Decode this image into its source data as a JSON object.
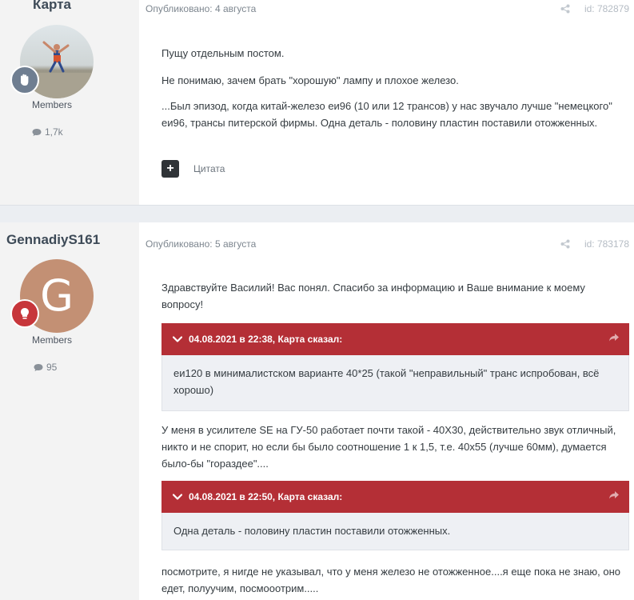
{
  "posts": [
    {
      "author": "Карта",
      "group": "Members",
      "post_count": "1,7k",
      "published": "Опубликовано: 4 августа",
      "id_label": "id: 782879",
      "paragraphs": [
        "Пущу отдельным постом.",
        "Не понимаю, зачем брать \"хорошую\" лампу и плохое железо.",
        "...Был эпизод, когда китай-железо еи96 (10 или 12 трансов) у нас звучало лучше \"немецкого\" еи96, трансы питерской фирмы. Одна деталь - половину пластин поставили отожженных."
      ],
      "quote_label": "Цитата"
    },
    {
      "author": "GennadiyS161",
      "avatar_letter": "G",
      "group": "Members",
      "post_count": "95",
      "published": "Опубликовано: 5 августа",
      "id_label": "id: 783178",
      "intro": "Здравствуйте Василий! Вас понял. Спасибо за информацию и Ваше внимание к моему вопросу!",
      "quote1": {
        "header": "04.08.2021 в 22:38, Карта сказал:",
        "text": "еи120 в минималистском варианте 40*25 (такой \"неправильный\" транс испробован, всё хорошо)"
      },
      "middle": "У меня в усилителе SE на ГУ-50 работает почти такой - 40Х30, действительно звук отличный, никто и не спорит, но если бы было соотношение 1 к 1,5, т.е. 40х55 (лучше 60мм), думается было-бы \"гораздее\"....",
      "quote2": {
        "header": "04.08.2021 в 22:50, Карта сказал:",
        "text": "Одна деталь - половину пластин поставили отожженных."
      },
      "outro": "посмотрите, я нигде не указывал, что у меня железо не отожженное....я еще пока не знаю, оно едет, полуучим, посмооотрим....."
    }
  ],
  "colors": {
    "quote_header": "#b42f36",
    "author_bg": "#f3f3f3",
    "page_bg": "#ebeef2"
  }
}
